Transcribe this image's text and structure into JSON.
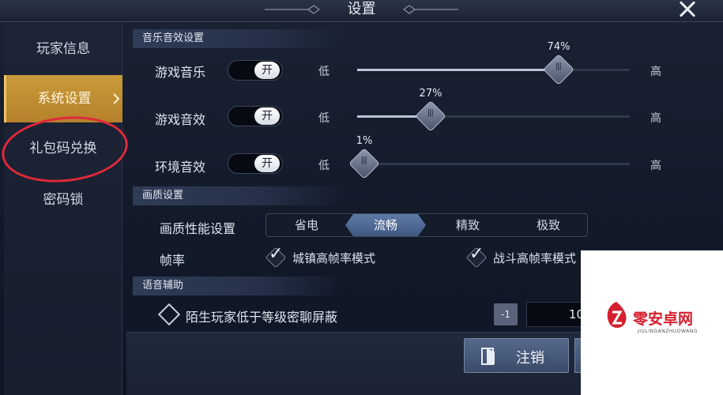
{
  "window": {
    "title": "设置"
  },
  "sidebar": {
    "items": [
      {
        "label": "玩家信息"
      },
      {
        "label": "系统设置"
      },
      {
        "label": "礼包码兑换"
      },
      {
        "label": "密码锁"
      }
    ]
  },
  "audio": {
    "header": "音乐音效设置",
    "rows": [
      {
        "label": "游戏音乐",
        "toggle": "开",
        "low": "低",
        "high": "高",
        "value_text": "74%",
        "value": 74
      },
      {
        "label": "游戏音效",
        "toggle": "开",
        "low": "低",
        "high": "高",
        "value_text": "27%",
        "value": 27
      },
      {
        "label": "环境音效",
        "toggle": "开",
        "low": "低",
        "high": "高",
        "value_text": "1%",
        "value": 1
      }
    ]
  },
  "quality": {
    "header": "画质设置",
    "performance_label": "画质性能设置",
    "options": [
      "省电",
      "流畅",
      "精致",
      "极致"
    ],
    "selected": "流畅",
    "framerate_label": "帧率",
    "framerate_options": [
      {
        "label": "城镇高帧率模式",
        "checked": true
      },
      {
        "label": "战斗高帧率模式",
        "checked": true
      }
    ]
  },
  "voice": {
    "header": "语音辅助",
    "block_label": "陌生玩家低于等级密聊屏蔽",
    "minus_label": "-1",
    "level_value": "10"
  },
  "footer": {
    "logout_label": "注销"
  },
  "watermark": {
    "title": "零安卓网",
    "subtitle": "JIULINGANZHUOWANG"
  },
  "colors": {
    "accent": "#c99a3a",
    "highlight": "#e0293a",
    "watermark_red": "#d4202f"
  }
}
